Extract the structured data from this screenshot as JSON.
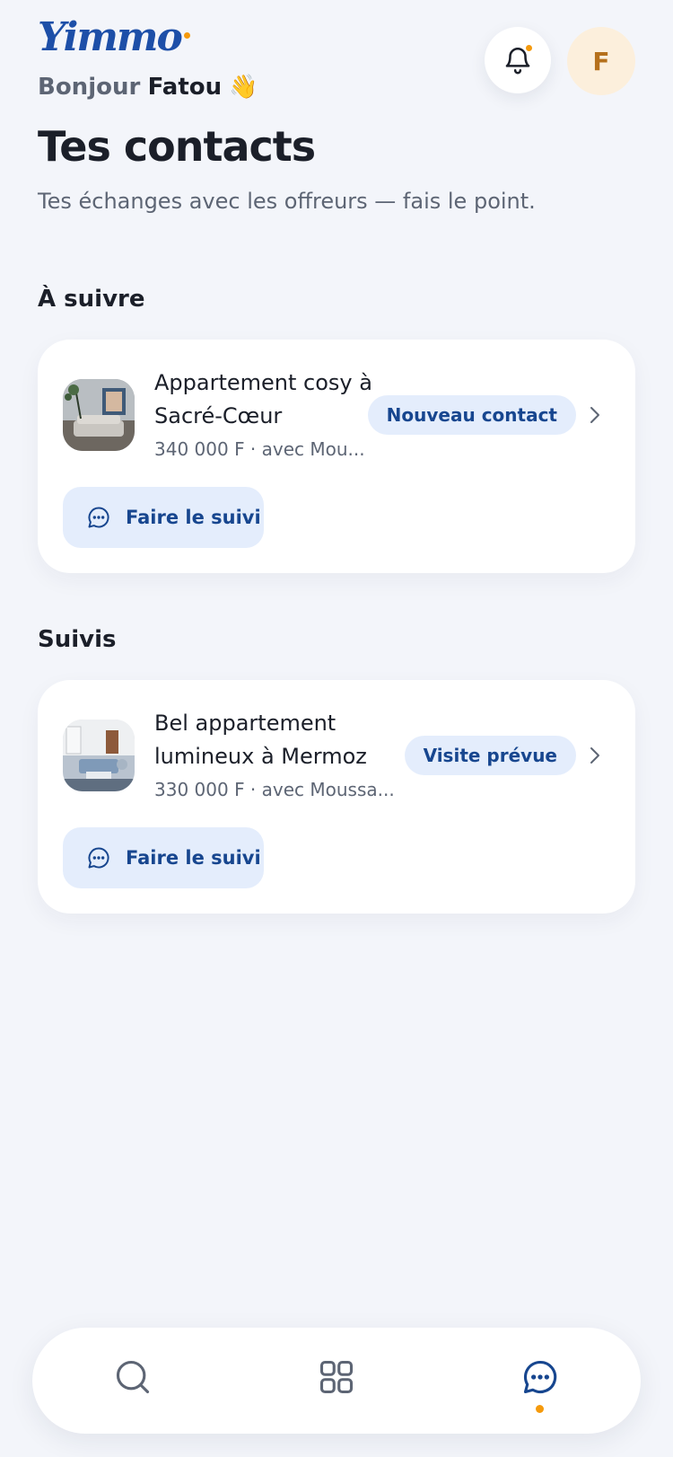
{
  "header": {
    "logo_text": "Yimmo",
    "greeting_hi": "Bonjour",
    "user_name": "Fatou",
    "wave_emoji": "👋",
    "avatar_initial": "F",
    "notification_icon": "bell-icon",
    "has_notification": true
  },
  "page": {
    "title": "Tes contacts",
    "subtitle": "Tes échanges avec les offreurs — fais le point."
  },
  "sections": [
    {
      "title": "À suivre",
      "contacts": [
        {
          "title": "Appartement cosy à Sacré-Cœur",
          "meta": "340 000 F · avec Mou...",
          "status": "Nouveau contact",
          "action_label": "Faire le suivi"
        }
      ]
    },
    {
      "title": "Suivis",
      "contacts": [
        {
          "title": "Bel appartement lumineux à Mermoz",
          "meta": "330 000 F · avec Moussa...",
          "status": "Visite prévue",
          "action_label": "Faire le suivi"
        }
      ]
    }
  ],
  "tabbar": {
    "items": [
      {
        "icon": "search-icon",
        "active": false
      },
      {
        "icon": "grid-icon",
        "active": false
      },
      {
        "icon": "chat-icon",
        "active": true
      }
    ]
  },
  "colors": {
    "accent": "#1d4fa8",
    "badge_bg": "#e4edfc",
    "notification_dot": "#f59a0c",
    "background": "#f3f5fa"
  }
}
